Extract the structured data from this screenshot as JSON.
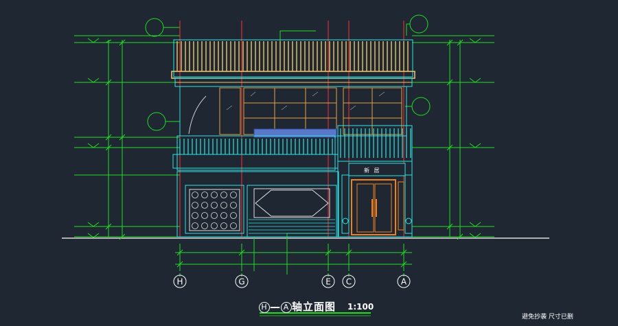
{
  "title": {
    "axis_from": "H",
    "dash": "—",
    "axis_to": "A",
    "text": "轴立面图",
    "scale": "1:100"
  },
  "note": "避免抄袭  尺寸已删",
  "door_sign": "新 居",
  "axis_labels": [
    "H",
    "G",
    "E",
    "C",
    "A"
  ],
  "colors": {
    "background": "#1f2733",
    "dimension": "#22dd22",
    "roof": "#f0c86a",
    "outline": "#2ee6e6",
    "axis_line": "#ff3030",
    "window": "#e8a040",
    "door": "#f08020",
    "wall_panel": "#e0e0e0"
  }
}
